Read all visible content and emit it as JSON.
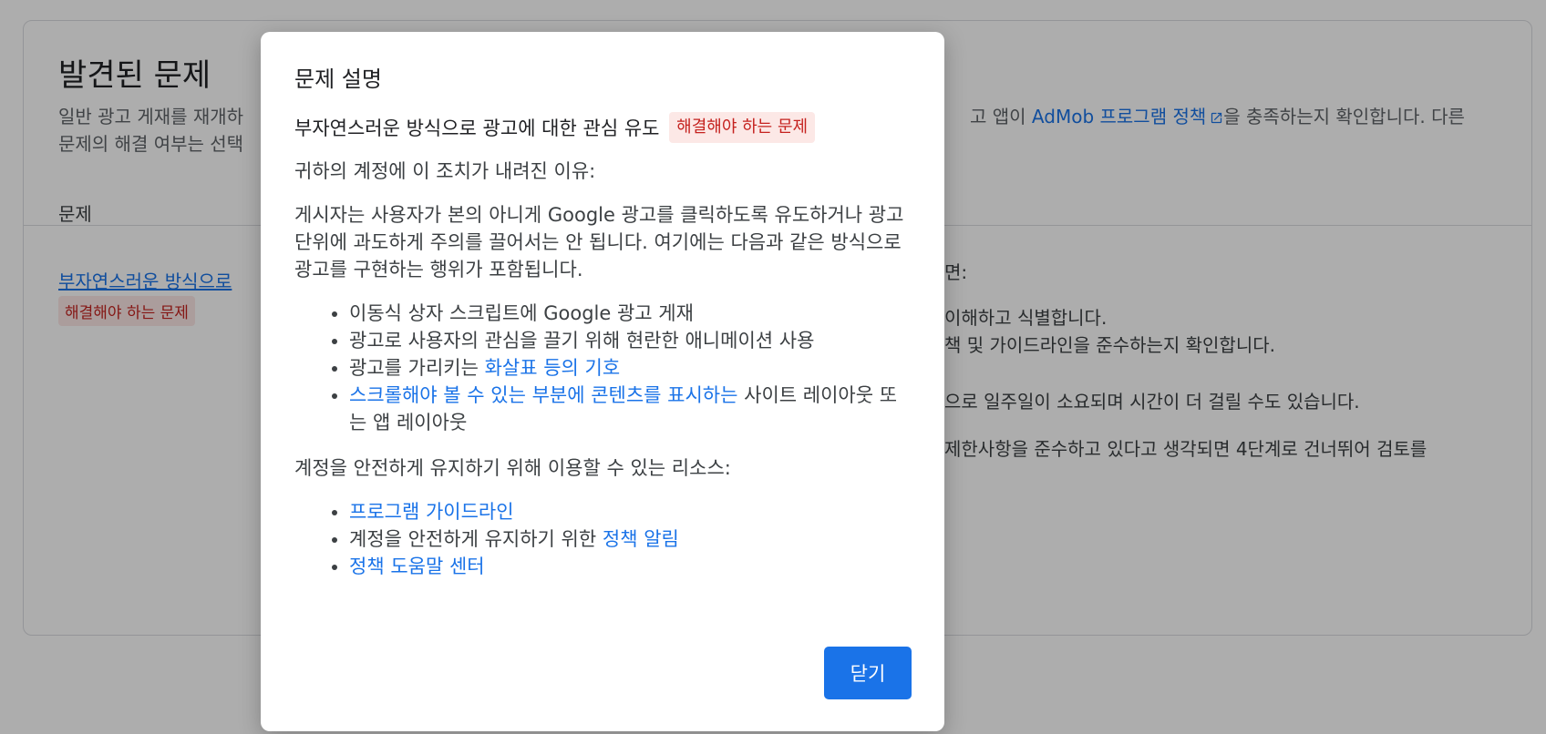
{
  "background": {
    "title": "발견된 문제",
    "desc_left_line1": "일반 광고 게재를 재개하",
    "desc_right_line1_pre": "고 앱이 ",
    "desc_link": "AdMob 프로그램 정책",
    "desc_right_line1_post": "을 충족하는지 확인합니다. 다른",
    "desc_left_line2": "문제의 해결 여부는 선택",
    "column_header": "문제",
    "issue_link": "부자연스러운 방식으로",
    "issue_status": "해결해야 하는 문제",
    "right_lines": [
      "면:",
      "이해하고 식별합니다.",
      "책 및 가이드라인을 준수하는지 확인합니다.",
      "으로 일주일이 소요되며 시간이 더 걸릴 수도 있습니다.",
      "제한사항을 준수하고 있다고 생각되면 4단계로 건너뛰어 검토를"
    ]
  },
  "dialog": {
    "title": "문제 설명",
    "issue_name": "부자연스러운 방식으로 광고에 대한 관심 유도",
    "issue_status": "해결해야 하는 문제",
    "reason_heading": "귀하의 계정에 이 조치가 내려진 이유:",
    "reason_body": "게시자는 사용자가 본의 아니게 Google 광고를 클릭하도록 유도하거나 광고 단위에 과도하게 주의를 끌어서는 안 됩니다. 여기에는 다음과 같은 방식으로 광고를 구현하는 행위가 포함됩니다.",
    "reasons": {
      "item1": "이동식 상자 스크립트에 Google 광고 게재",
      "item2": "광고로 사용자의 관심을 끌기 위해 현란한 애니메이션 사용",
      "item3_text": "광고를 가리키는 ",
      "item3_link": "화살표 등의 기호",
      "item4_link": "스크롤해야 볼 수 있는 부분에 콘텐츠를 표시하는",
      "item4_text": " 사이트 레이아웃 또는 앱 레이아웃"
    },
    "resources_heading": "계정을 안전하게 유지하기 위해 이용할 수 있는 리소스:",
    "resources": {
      "item1_link": "프로그램 가이드라인",
      "item2_text": "계정을 안전하게 유지하기 위한 ",
      "item2_link": "정책 알림",
      "item3_link": "정책 도움말 센터"
    },
    "close_label": "닫기"
  },
  "colors": {
    "primary": "#1a73e8",
    "error_text": "#c5221f",
    "error_bg": "#fce8e6",
    "scrim": "rgba(0,0,0,0.32)"
  }
}
